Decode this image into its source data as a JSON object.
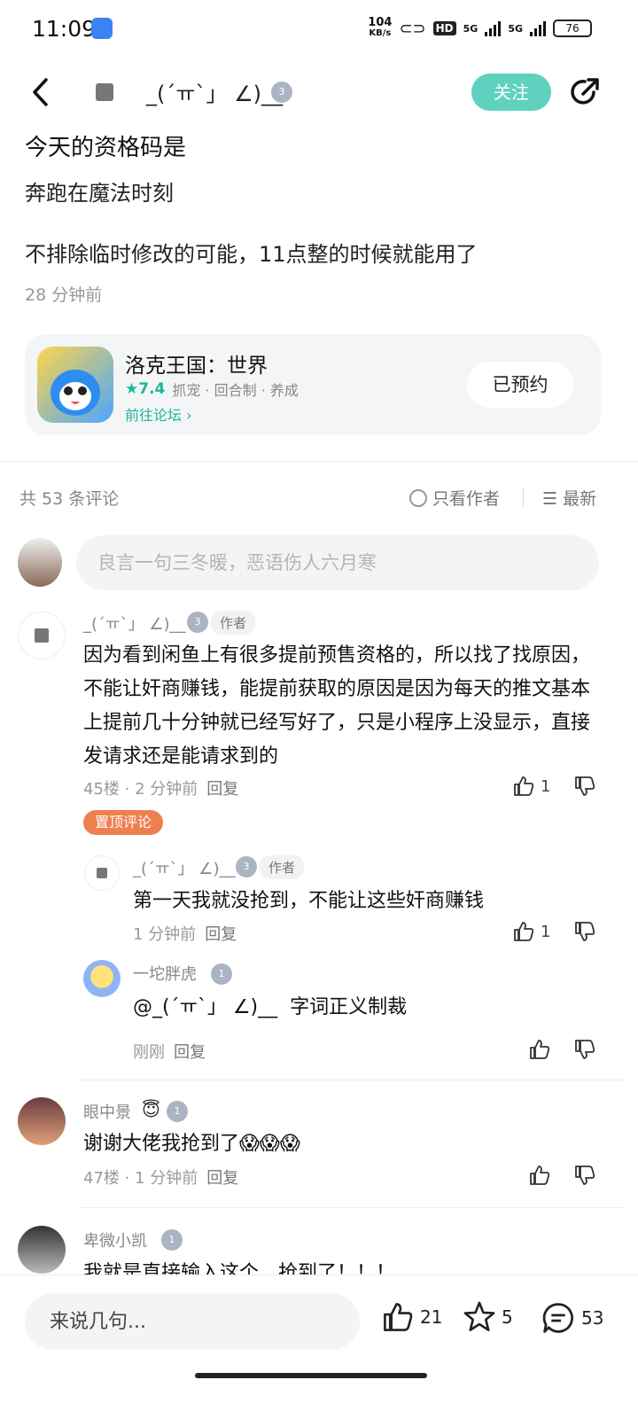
{
  "status": {
    "time": "11:09",
    "net_speed": "104",
    "net_unit": "KB/s",
    "hd": "HD",
    "sim1": "5G",
    "sim2": "5G",
    "battery": "76"
  },
  "nav": {
    "author_name": "_(´ㅠ`」 ∠)__",
    "level": "3",
    "follow_label": "关注"
  },
  "post": {
    "title": "今天的资格码是",
    "line1": "奔跑在魔法时刻",
    "line2": "不排除临时修改的可能，11点整的时候就能用了",
    "time": "28 分钟前"
  },
  "game": {
    "name": "洛克王国：世界",
    "rating": "★7.4",
    "tags": "抓宠 · 回合制 · 养成",
    "forum_link": "前往论坛 ›",
    "reserve_label": "已预约"
  },
  "comments_header": {
    "count_text": "共 53 条评论",
    "only_author": "只看作者",
    "sort": "☰ 最新"
  },
  "comment_input": {
    "placeholder": "良言一句三冬暖，恶语伤人六月寒"
  },
  "comments": [
    {
      "name": "_(´ㅠ`」 ∠)__",
      "author_tag": "作者",
      "text": "因为看到闲鱼上有很多提前预售资格的，所以找了找原因，不能让奸商赚钱，能提前获取的原因是因为每天的推文基本上提前几十分钟就已经写好了，只是小程序上没显示，直接发请求还是能请求到的",
      "meta": "45楼 · 2 分钟前",
      "reply": "回复",
      "likes": "1",
      "pin": "置顶评论"
    },
    {
      "name": "_(´ㅠ`」 ∠)__",
      "author_tag": "作者",
      "text": "第一天我就没抢到，不能让这些奸商赚钱",
      "meta": "1 分钟前",
      "reply": "回复",
      "likes": "1"
    },
    {
      "name": "一坨胖虎",
      "mention": "@_(´ㅠ`」 ∠)__",
      "text": "字词正义制裁",
      "meta": "刚刚",
      "reply": "回复"
    },
    {
      "name": "眼中景",
      "text": "谢谢大佬我抢到了😱😱😱",
      "meta": "47楼 · 1 分钟前",
      "reply": "回复"
    },
    {
      "name": "卑微小凯",
      "text": "我就是直接输入这个，抢到了！！！"
    }
  ],
  "bottom": {
    "input_placeholder": "来说几句...",
    "likes": "21",
    "stars": "5",
    "comments": "53"
  }
}
